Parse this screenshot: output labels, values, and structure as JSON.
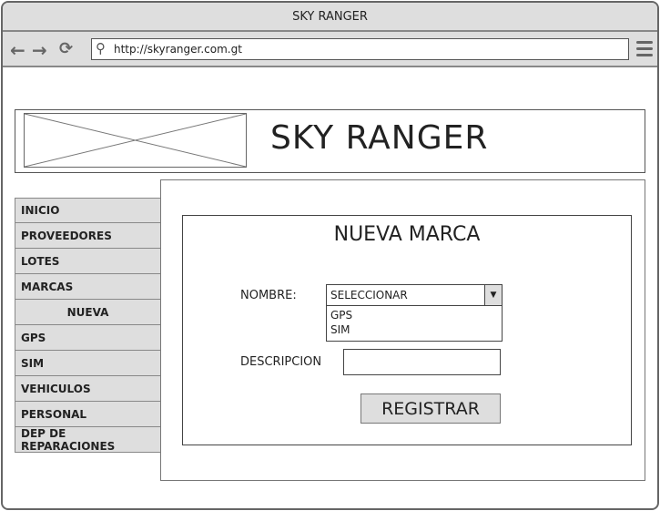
{
  "browser": {
    "title": "SKY RANGER",
    "url": "http://skyranger.com.gt",
    "icons": [
      "back-arrow-icon",
      "forward-arrow-icon",
      "refresh-icon",
      "search-icon",
      "hamburger-menu-icon"
    ]
  },
  "header": {
    "brand": "SKY RANGER"
  },
  "sidebar": {
    "items": [
      {
        "label": "INICIO"
      },
      {
        "label": "PROVEEDORES"
      },
      {
        "label": "LOTES"
      },
      {
        "label": "MARCAS"
      },
      {
        "label": "NUEVA"
      },
      {
        "label": "GPS"
      },
      {
        "label": "SIM"
      },
      {
        "label": "VEHICULOS"
      },
      {
        "label": "PERSONAL"
      },
      {
        "label": "DEP DE REPARACIONES"
      }
    ]
  },
  "form": {
    "title": "NUEVA MARCA",
    "nombre_label": "NOMBRE:",
    "select_value": "SELECCIONAR",
    "options": [
      "GPS",
      "SIM"
    ],
    "descripcion_label": "DESCRIPCION",
    "descripcion_value": "",
    "submit": "REGISTRAR"
  }
}
